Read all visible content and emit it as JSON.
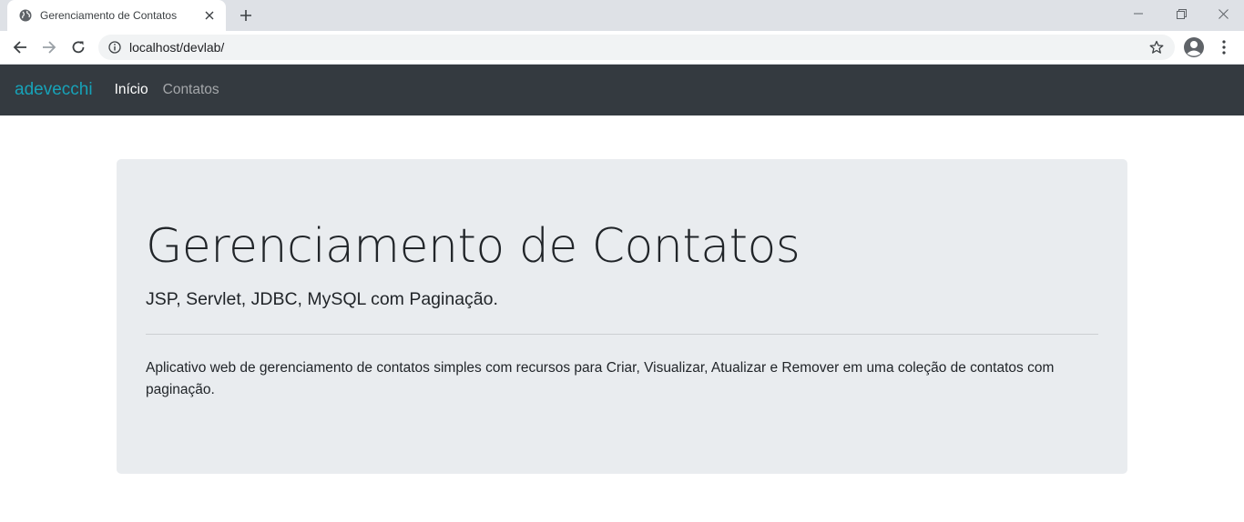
{
  "browser": {
    "tab_title": "Gerenciamento de Contatos",
    "url": "localhost/devlab/"
  },
  "navbar": {
    "brand": "adevecchi",
    "links": [
      {
        "label": "Início",
        "active": true
      },
      {
        "label": "Contatos",
        "active": false
      }
    ]
  },
  "jumbotron": {
    "title": "Gerenciamento de Contatos",
    "lead": "JSP, Servlet, JDBC, MySQL com Paginação.",
    "description": "Aplicativo web de gerenciamento de contatos simples com recursos para Criar, Visualizar, Atualizar e Remover em uma coleção de contatos com paginação."
  },
  "colors": {
    "navbar_bg": "#343a40",
    "brand": "#17a2b8",
    "jumbotron_bg": "#e9ecef"
  },
  "icons": [
    "globe-icon",
    "close-icon",
    "plus-icon",
    "minimize-icon",
    "restore-icon",
    "window-close-icon",
    "back-arrow-icon",
    "forward-arrow-icon",
    "reload-icon",
    "info-icon",
    "star-icon",
    "account-icon",
    "kebab-menu-icon"
  ]
}
